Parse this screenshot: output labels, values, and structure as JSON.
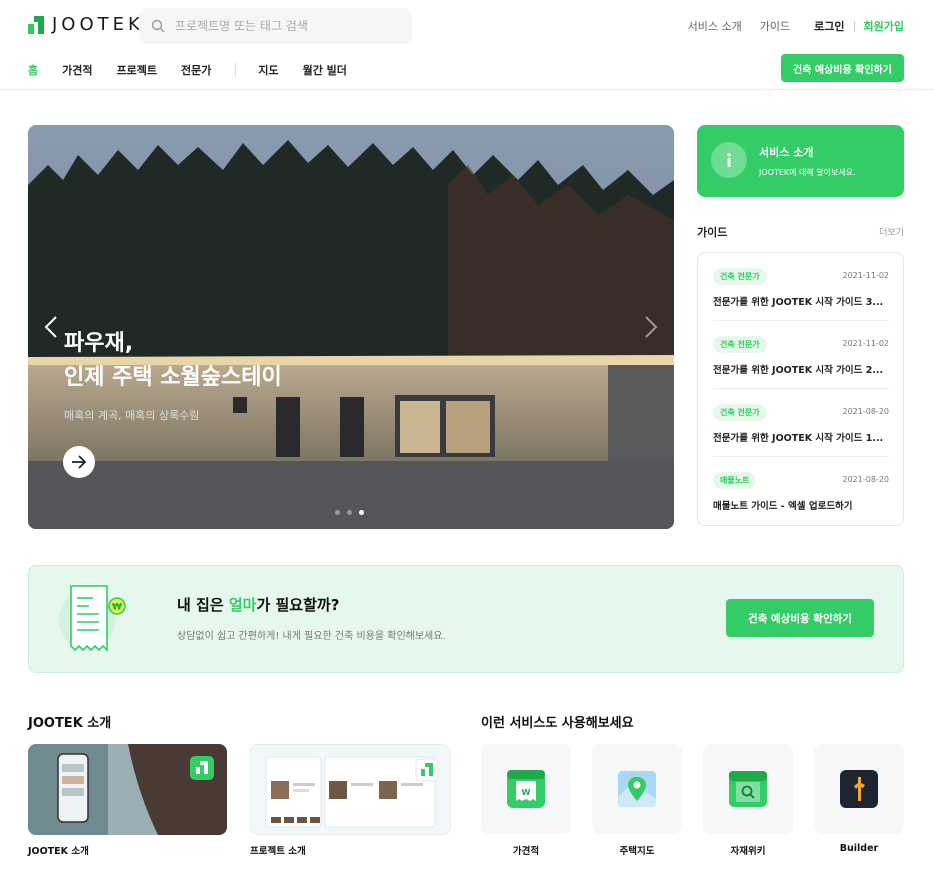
{
  "header": {
    "logo_text": "JOOTEK",
    "search_placeholder": "프로젝트명 또는 태그 검색",
    "top_links": [
      "서비스 소개",
      "가이드",
      "로그인",
      "회원가입"
    ],
    "nav": [
      "홈",
      "가견적",
      "프로젝트",
      "전문가",
      "지도",
      "월간 빌더"
    ],
    "cta": "건축 예상비용 확인하기"
  },
  "hero": {
    "title_line1": "파우재,",
    "title_line2": "인제 주택 소월숲스테이",
    "subtitle": "매혹의 계곡, 매혹의 상록수림",
    "slide_count": 3,
    "active_slide": 3
  },
  "service_card": {
    "title": "서비스 소개",
    "desc": "JOOTEK에 대해 알아보세요."
  },
  "guide": {
    "title": "가이드",
    "more": "더보기",
    "items": [
      {
        "tag": "건축 전문가",
        "date": "2021-11-02",
        "text": "전문가를 위한 JOOTEK 시작 가이드 3..."
      },
      {
        "tag": "건축 전문가",
        "date": "2021-11-02",
        "text": "전문가를 위한 JOOTEK 시작 가이드 2..."
      },
      {
        "tag": "건축 전문가",
        "date": "2021-08-20",
        "text": "전문가를 위한 JOOTEK 시작 가이드 1..."
      },
      {
        "tag": "매물노트",
        "date": "2021-08-20",
        "text": "매물노트 가이드 - 엑셀 업로드하기"
      }
    ]
  },
  "banner": {
    "title_pre": "내 집은 ",
    "title_highlight": "얼마",
    "title_post": "가 필요할까?",
    "desc": "상담없이 쉽고 간편하게! 내게 필요한 건축 비용을 확인해보세요.",
    "button": "건축 예상비용 확인하기"
  },
  "intro": {
    "title": "JOOTEK 소개",
    "cards": [
      "JOOTEK 소개",
      "프로젝트 소개"
    ]
  },
  "services": {
    "title": "이런 서비스도 사용해보세요",
    "items": [
      {
        "label": "가견적",
        "icon": "estimate-icon"
      },
      {
        "label": "주택지도",
        "icon": "map-icon"
      },
      {
        "label": "자재위키",
        "icon": "wiki-icon"
      },
      {
        "label": "Builder",
        "icon": "builder-icon"
      }
    ]
  },
  "colors": {
    "accent": "#33cc66",
    "light_accent": "#e6f8ed"
  }
}
